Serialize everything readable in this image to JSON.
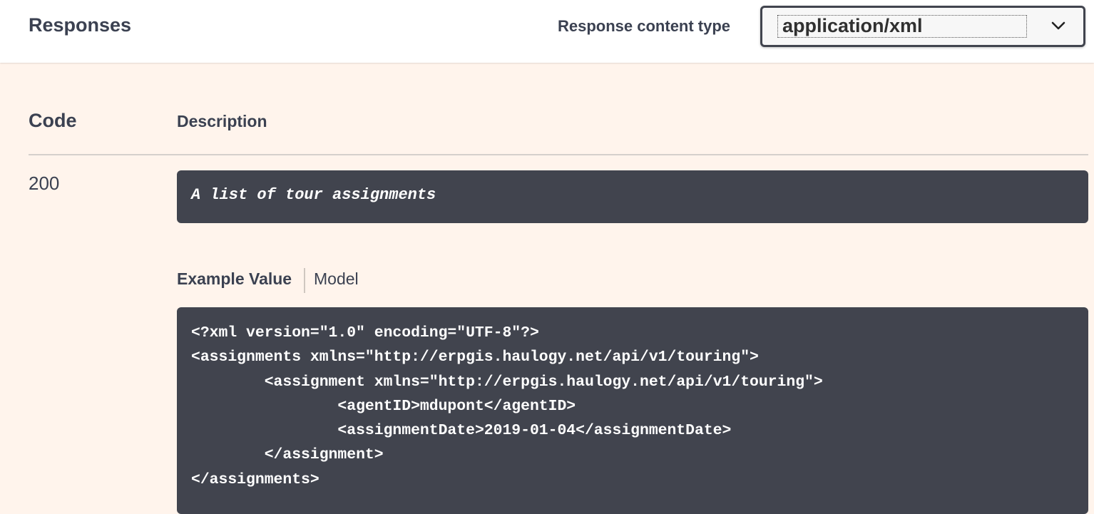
{
  "header": {
    "title": "Responses",
    "content_type_label": "Response content type",
    "content_type_value": "application/xml"
  },
  "table": {
    "col_code": "Code",
    "col_description": "Description"
  },
  "response": {
    "code": "200",
    "description": "A list of tour assignments",
    "tabs": {
      "example_value": "Example Value",
      "model": "Model"
    },
    "example_lines": [
      "<?xml version=\"1.0\" encoding=\"UTF-8\"?>",
      "<assignments xmlns=\"http://erpgis.haulogy.net/api/v1/touring\">",
      "\t<assignment xmlns=\"http://erpgis.haulogy.net/api/v1/touring\">",
      "\t\t<agentID>mdupont</agentID>",
      "\t\t<assignmentDate>2019-01-04</assignmentDate>",
      "\t</assignment>",
      "</assignments>"
    ]
  },
  "icons": {
    "select_arrow": "chevron-down-icon"
  },
  "colors": {
    "background": "#fff4ec",
    "header_bg": "#ffffff",
    "text": "#3b4151",
    "code_bg": "#41444e",
    "code_text": "#ffffff"
  }
}
